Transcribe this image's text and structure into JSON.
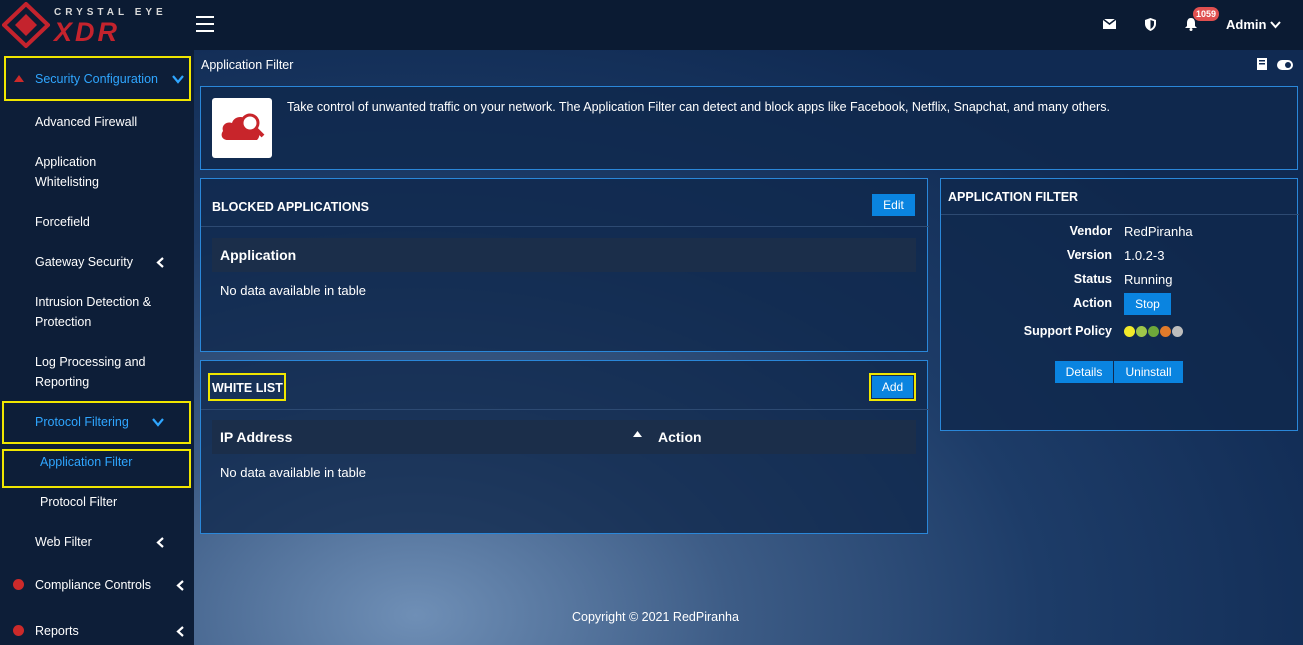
{
  "brand": {
    "sub": "CRYSTAL EYE",
    "main": "XDR",
    "accent": "#c4232d"
  },
  "topbar": {
    "notifications_count": "1059",
    "user": "Admin"
  },
  "sidebar": {
    "items": [
      {
        "label": "Security Configuration"
      },
      {
        "label": "Advanced Firewall"
      },
      {
        "label": "Application"
      },
      {
        "label": "Whitelisting"
      },
      {
        "label": "Forcefield"
      },
      {
        "label": "Gateway Security"
      },
      {
        "label": "Intrusion Detection &"
      },
      {
        "label": "Protection"
      },
      {
        "label": "Log Processing and"
      },
      {
        "label": "Reporting"
      },
      {
        "label": "Protocol Filtering"
      },
      {
        "label": "Application Filter"
      },
      {
        "label": "Protocol Filter"
      },
      {
        "label": "Web Filter"
      },
      {
        "label": "Compliance Controls"
      },
      {
        "label": "Reports"
      }
    ]
  },
  "page": {
    "title": "Application Filter",
    "intro": "Take control of unwanted traffic on your network. The Application Filter can detect and block apps like Facebook, Netflix, Snapchat, and many others."
  },
  "blocked": {
    "title": "BLOCKED APPLICATIONS",
    "edit_label": "Edit",
    "column": "Application",
    "empty": "No data available in table"
  },
  "whitelist": {
    "title": "WHITE LIST",
    "add_label": "Add",
    "col_ip": "IP Address",
    "col_action": "Action",
    "empty": "No data available in table"
  },
  "info": {
    "title": "APPLICATION FILTER",
    "vendor_label": "Vendor",
    "vendor": "RedPiranha",
    "version_label": "Version",
    "version": "1.0.2-3",
    "status_label": "Status",
    "status": "Running",
    "action_label": "Action",
    "stop_label": "Stop",
    "policy_label": "Support Policy",
    "policy_colors": [
      "#f2ea2a",
      "#9ec64a",
      "#6ea83a",
      "#e07a2a",
      "#bdbdbd"
    ],
    "details_label": "Details",
    "uninstall_label": "Uninstall"
  },
  "footer": {
    "copyright": "Copyright © 2021 RedPiranha"
  }
}
